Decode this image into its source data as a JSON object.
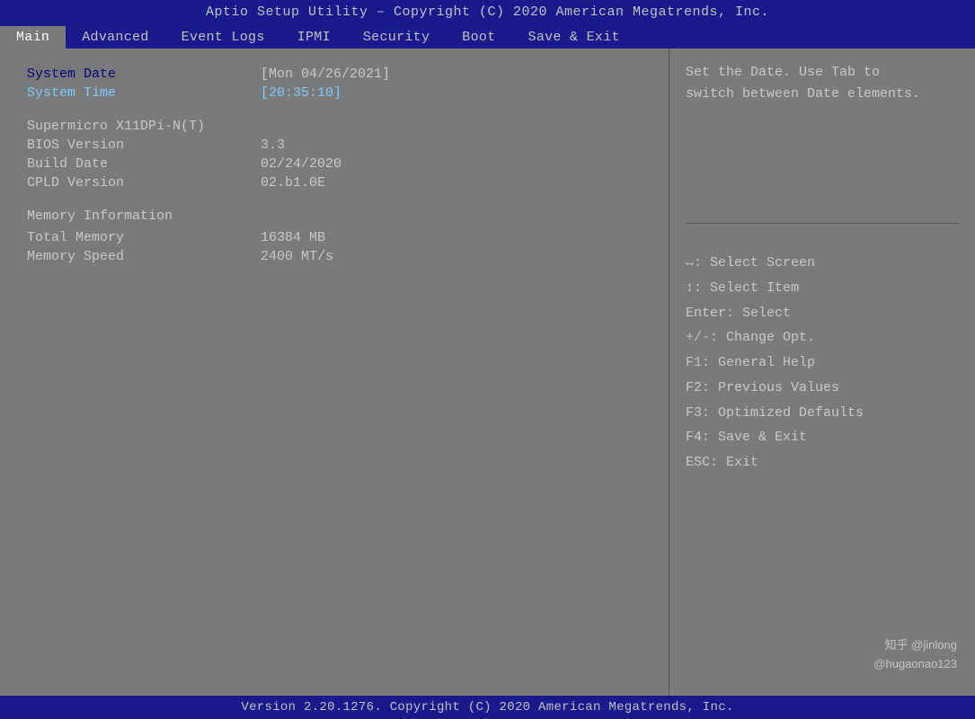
{
  "title_bar": {
    "text": "Aptio Setup Utility – Copyright (C) 2020 American Megatrends, Inc."
  },
  "nav": {
    "items": [
      {
        "label": "Main",
        "active": true
      },
      {
        "label": "Advanced",
        "active": false
      },
      {
        "label": "Event Logs",
        "active": false
      },
      {
        "label": "IPMI",
        "active": false
      },
      {
        "label": "Security",
        "active": false
      },
      {
        "label": "Boot",
        "active": false
      },
      {
        "label": "Save & Exit",
        "active": false
      }
    ]
  },
  "main_panel": {
    "system_date_label": "System Date",
    "system_date_value": "[Mon 04/26/2021]",
    "system_time_label": "System Time",
    "system_time_value": "[20:35:10]",
    "board_label": "Supermicro X11DPi-N(T)",
    "bios_version_label": "BIOS Version",
    "bios_version_value": "3.3",
    "build_date_label": "Build Date",
    "build_date_value": "02/24/2020",
    "cpld_version_label": "CPLD Version",
    "cpld_version_value": "02.b1.0E",
    "memory_info_label": "Memory Information",
    "total_memory_label": "Total Memory",
    "total_memory_value": "16384 MB",
    "memory_speed_label": "Memory Speed",
    "memory_speed_value": "2400 MT/s"
  },
  "right_panel": {
    "help_text_line1": "Set the Date. Use Tab to",
    "help_text_line2": "switch between Date elements.",
    "keys": [
      "↔: Select Screen",
      "↕: Select Item",
      "Enter: Select",
      "+/-: Change Opt.",
      "F1: General Help",
      "F2: Previous Values",
      "F3: Optimized Defaults",
      "F4: Save & Exit",
      "ESC: Exit"
    ]
  },
  "footer": {
    "text": "Version 2.20.1276. Copyright (C) 2020 American Megatrends, Inc."
  },
  "watermark": {
    "line1": "知乎 @jinlong",
    "line2": "@hugaonao123"
  }
}
